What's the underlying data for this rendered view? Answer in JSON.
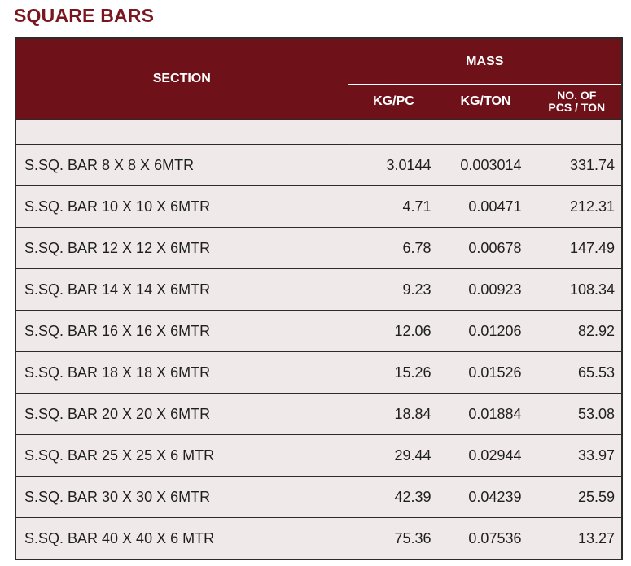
{
  "title": "SQUARE BARS",
  "table": {
    "header": {
      "section": "SECTION",
      "mass": "MASS",
      "kg_pc": "KG/PC",
      "kg_ton": "KG/TON",
      "pcs_line1": "NO. OF",
      "pcs_line2": "PCS / TON"
    },
    "rows": [
      {
        "section": "S.SQ. BAR 8 X 8 X 6MTR",
        "kg_pc": "3.0144",
        "kg_ton": "0.003014",
        "pcs_ton": "331.74"
      },
      {
        "section": "S.SQ. BAR 10 X 10 X 6MTR",
        "kg_pc": "4.71",
        "kg_ton": "0.00471",
        "pcs_ton": "212.31"
      },
      {
        "section": "S.SQ. BAR 12 X 12 X 6MTR",
        "kg_pc": "6.78",
        "kg_ton": "0.00678",
        "pcs_ton": "147.49"
      },
      {
        "section": "S.SQ. BAR 14 X 14 X 6MTR",
        "kg_pc": "9.23",
        "kg_ton": "0.00923",
        "pcs_ton": "108.34"
      },
      {
        "section": "S.SQ. BAR 16 X 16 X 6MTR",
        "kg_pc": "12.06",
        "kg_ton": "0.01206",
        "pcs_ton": "82.92"
      },
      {
        "section": "S.SQ. BAR 18 X 18 X 6MTR",
        "kg_pc": "15.26",
        "kg_ton": "0.01526",
        "pcs_ton": "65.53"
      },
      {
        "section": "S.SQ. BAR 20 X 20 X 6MTR",
        "kg_pc": "18.84",
        "kg_ton": "0.01884",
        "pcs_ton": "53.08"
      },
      {
        "section": "S.SQ. BAR 25 X 25 X 6 MTR",
        "kg_pc": "29.44",
        "kg_ton": "0.02944",
        "pcs_ton": "33.97"
      },
      {
        "section": "S.SQ. BAR 30 X 30  X 6MTR",
        "kg_pc": "42.39",
        "kg_ton": "0.04239",
        "pcs_ton": "25.59"
      },
      {
        "section": "S.SQ. BAR 40 X 40 X 6 MTR",
        "kg_pc": "75.36",
        "kg_ton": "0.07536",
        "pcs_ton": "13.27"
      }
    ]
  },
  "colors": {
    "header_bg": "#6e1119",
    "title_text": "#7a1620",
    "cell_bg": "#efe9e9"
  }
}
